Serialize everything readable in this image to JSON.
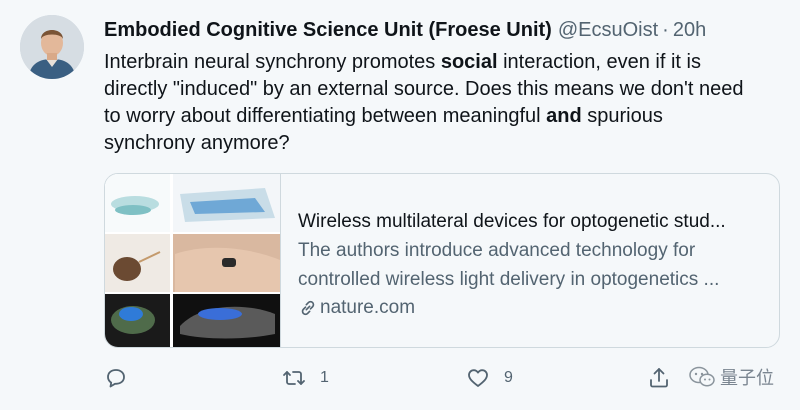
{
  "tweet": {
    "author_name": "Embodied Cognitive Science Unit (Froese Unit)",
    "handle": "@EcsuOist",
    "separator": "·",
    "time": "20h",
    "text_parts": {
      "p1": "Interbrain neural synchrony promotes ",
      "b1": "social",
      "p2": " interaction, even if it is directly \"induced\" by an external source. Does this means we don't need to worry about differentiating between meaningful ",
      "b2": "and",
      "p3": " spurious synchrony anymore?"
    }
  },
  "card": {
    "title": "Wireless multilateral devices for optogenetic stud...",
    "description_line1": "The authors introduce advanced technology for",
    "description_line2": "controlled wireless light delivery in optogenetics ...",
    "domain": "nature.com"
  },
  "actions": {
    "reply_icon": "reply-icon",
    "retweet_icon": "retweet-icon",
    "retweet_count": "1",
    "like_icon": "heart-icon",
    "like_count": "9",
    "share_icon": "share-icon"
  },
  "watermark": {
    "text": "量子位",
    "icon": "wechat-icon"
  },
  "colors": {
    "background": "#f5f8fa",
    "text_primary": "#0f1419",
    "text_secondary": "#536471",
    "border": "#cfd9de"
  }
}
